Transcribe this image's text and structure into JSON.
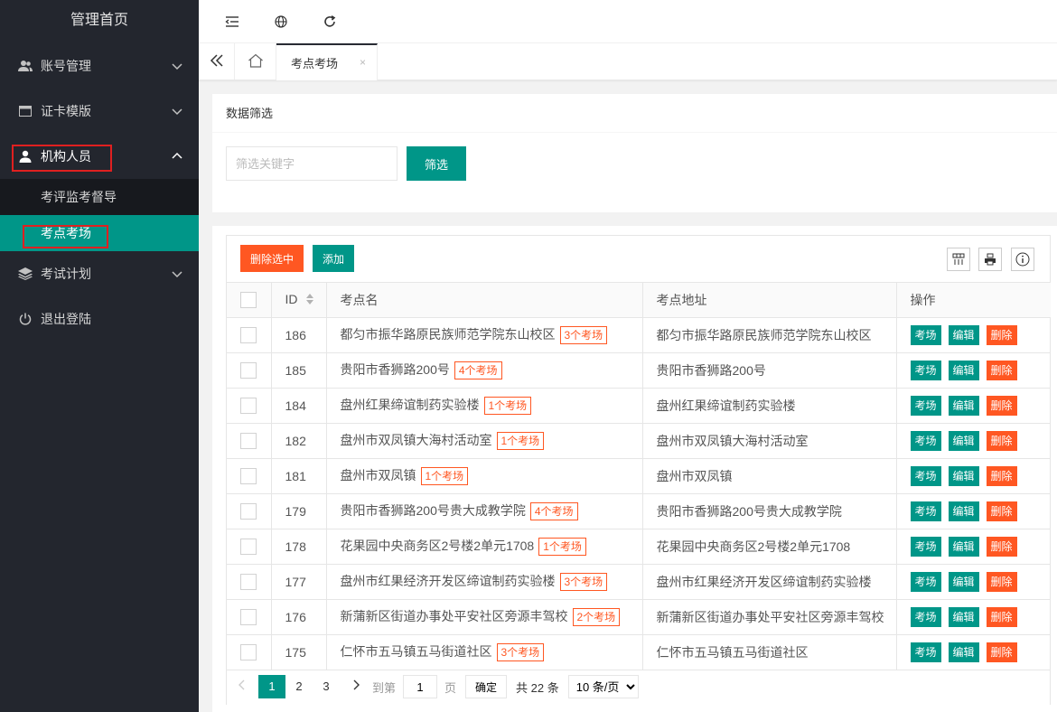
{
  "sidebar": {
    "title": "管理首页",
    "items": [
      {
        "label": "账号管理"
      },
      {
        "label": "证卡模版"
      },
      {
        "label": "机构人员"
      },
      {
        "label": "考试计划"
      },
      {
        "label": "退出登陆"
      }
    ],
    "sub_items": [
      {
        "label": "考评监考督导"
      },
      {
        "label": "考点考场"
      }
    ]
  },
  "tabs": {
    "active_label": "考点考场",
    "close": "×"
  },
  "filter": {
    "title": "数据筛选",
    "placeholder": "筛选关键字",
    "button": "筛选"
  },
  "toolbar": {
    "delete_selected": "删除选中",
    "add": "添加"
  },
  "table": {
    "headers": {
      "id": "ID",
      "name": "考点名",
      "address": "考点地址",
      "ops": "操作"
    },
    "op_labels": {
      "rooms": "考场",
      "edit": "编辑",
      "delete": "删除"
    },
    "rows": [
      {
        "id": "186",
        "name": "都匀市振华路原民族师范学院东山校区",
        "badge": "3个考场",
        "address": "都匀市振华路原民族师范学院东山校区"
      },
      {
        "id": "185",
        "name": "贵阳市香狮路200号",
        "badge": "4个考场",
        "address": "贵阳市香狮路200号"
      },
      {
        "id": "184",
        "name": "盘州红果缔谊制药实验楼",
        "badge": "1个考场",
        "address": "盘州红果缔谊制药实验楼"
      },
      {
        "id": "182",
        "name": "盘州市双凤镇大海村活动室",
        "badge": "1个考场",
        "address": "盘州市双凤镇大海村活动室"
      },
      {
        "id": "181",
        "name": "盘州市双凤镇",
        "badge": "1个考场",
        "address": "盘州市双凤镇"
      },
      {
        "id": "179",
        "name": "贵阳市香狮路200号贵大成教学院",
        "badge": "4个考场",
        "address": "贵阳市香狮路200号贵大成教学院"
      },
      {
        "id": "178",
        "name": "花果园中央商务区2号楼2单元1708",
        "badge": "1个考场",
        "address": "花果园中央商务区2号楼2单元1708"
      },
      {
        "id": "177",
        "name": "盘州市红果经济开发区缔谊制药实验楼",
        "badge": "3个考场",
        "address": "盘州市红果经济开发区缔谊制药实验楼"
      },
      {
        "id": "176",
        "name": "新蒲新区街道办事处平安社区旁源丰驾校",
        "badge": "2个考场",
        "address": "新蒲新区街道办事处平安社区旁源丰驾校"
      },
      {
        "id": "175",
        "name": "仁怀市五马镇五马街道社区",
        "badge": "3个考场",
        "address": "仁怀市五马镇五马街道社区"
      }
    ]
  },
  "pager": {
    "pages": [
      "1",
      "2",
      "3"
    ],
    "goto": "到第",
    "input": "1",
    "page_unit": "页",
    "confirm": "确定",
    "total": "共 22 条",
    "per_page": "10 条/页"
  },
  "colors": {
    "primary": "#009688",
    "danger": "#ff5722",
    "sidebar": "#23262e"
  }
}
